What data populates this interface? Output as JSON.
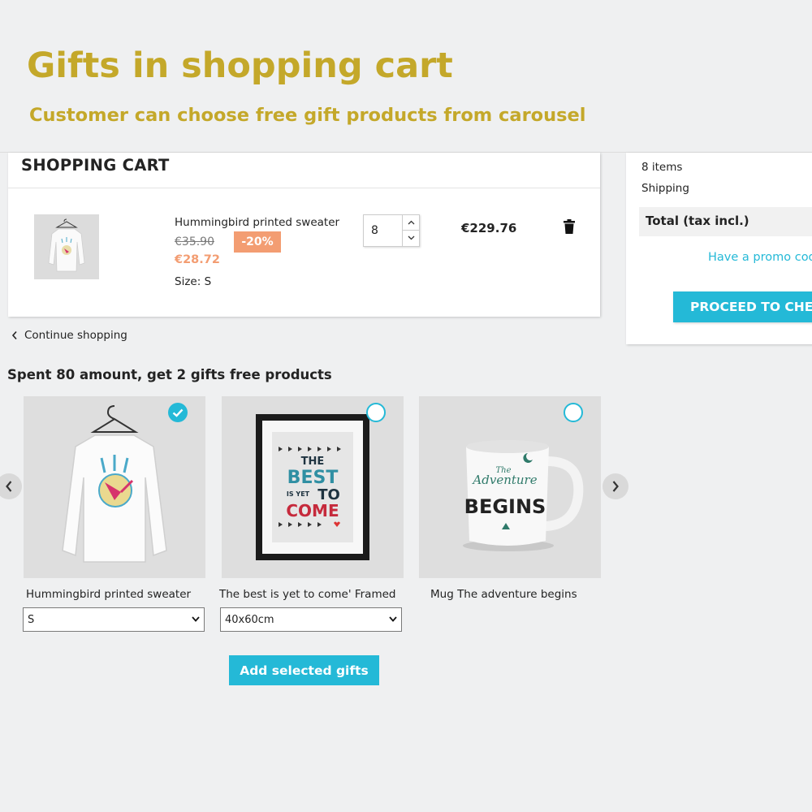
{
  "banner": {
    "title": "Gifts in shopping cart",
    "subtitle": "Customer can choose free gift products from carousel"
  },
  "cart": {
    "title": "SHOPPING CART",
    "item": {
      "name": "Hummingbird printed sweater",
      "old_price": "€35.90",
      "discount": "-20%",
      "new_price": "€28.72",
      "size_label": "Size:",
      "size_value": "S",
      "quantity": "8",
      "line_total": "€229.76"
    },
    "continue_label": "Continue shopping"
  },
  "summary": {
    "items": "8 items",
    "shipping": "Shipping",
    "total_label": "Total (tax incl.)",
    "promo_link": "Have a promo code?",
    "checkout_label": "PROCEED TO CHECKOUT"
  },
  "gifts": {
    "heading": "Spent 80 amount, get 2 gifts free products",
    "products": [
      {
        "name": "Hummingbird printed sweater",
        "selected": true,
        "option": "S"
      },
      {
        "name": "The best is yet to come' Framed",
        "selected": false,
        "option": "40x60cm"
      },
      {
        "name": "Mug The adventure begins",
        "selected": false
      }
    ],
    "add_label": "Add selected gifts"
  },
  "poster_text": {
    "the": "THE",
    "best": "BEST",
    "is_yet": "IS YET",
    "to": "TO",
    "come": "COME"
  },
  "mug_text": {
    "the": "The",
    "adventure": "Adventure",
    "begins": "BEGINS"
  },
  "colors": {
    "accent": "#24b9d7",
    "discount": "#f39d72",
    "banner": "#c4a82a",
    "background": "#eff0f1"
  }
}
